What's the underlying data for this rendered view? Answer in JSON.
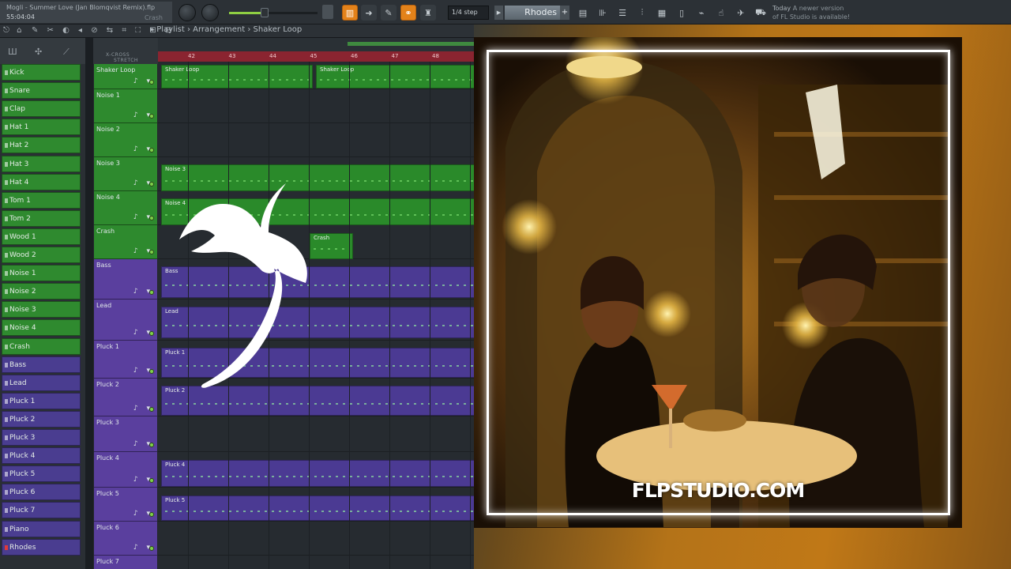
{
  "project": {
    "title": "Mogli - Summer Love (Jan Blomqvist Remix).flp",
    "time": "55:04:04",
    "hint_label": "Crash"
  },
  "toolbar": {
    "snap_value": "1/4 step",
    "pattern_name": "Rhodes",
    "pattern_add": "+",
    "news_date": "Today",
    "news_text_1": "A newer version",
    "news_text_2": "of FL Studio is available!",
    "master_volume_percent": 40,
    "accent_color": "#e3821a"
  },
  "breadcrumb": {
    "root": "Playlist",
    "sep1": "›",
    "section": "Arrangement",
    "sep2": "›",
    "item": "Shaker Loop"
  },
  "rack_header_icons": [
    "piano-icon",
    "step-icon",
    "graph-icon"
  ],
  "channels": [
    {
      "label": "Kick",
      "color": "g"
    },
    {
      "label": "Snare",
      "color": "g"
    },
    {
      "label": "Clap",
      "color": "g"
    },
    {
      "label": "Hat 1",
      "color": "g"
    },
    {
      "label": "Hat 2",
      "color": "g"
    },
    {
      "label": "Hat 3",
      "color": "g"
    },
    {
      "label": "Hat 4",
      "color": "g"
    },
    {
      "label": "Tom 1",
      "color": "g"
    },
    {
      "label": "Tom 2",
      "color": "g"
    },
    {
      "label": "Wood 1",
      "color": "g"
    },
    {
      "label": "Wood 2",
      "color": "g"
    },
    {
      "label": "Noise 1",
      "color": "g"
    },
    {
      "label": "Noise 2",
      "color": "g"
    },
    {
      "label": "Noise 3",
      "color": "g"
    },
    {
      "label": "Noise 4",
      "color": "g"
    },
    {
      "label": "Crash",
      "color": "g"
    },
    {
      "label": "Bass",
      "color": "p"
    },
    {
      "label": "Lead",
      "color": "p"
    },
    {
      "label": "Pluck 1",
      "color": "p"
    },
    {
      "label": "Pluck 2",
      "color": "p"
    },
    {
      "label": "Pluck 3",
      "color": "p"
    },
    {
      "label": "Pluck 4",
      "color": "p"
    },
    {
      "label": "Pluck 5",
      "color": "p"
    },
    {
      "label": "Pluck 6",
      "color": "p"
    },
    {
      "label": "Pluck 7",
      "color": "p"
    },
    {
      "label": "Piano",
      "color": "p"
    },
    {
      "label": "Rhodes",
      "color": "r"
    }
  ],
  "tracks_header": {
    "crossfade": "X-CROSS",
    "stretch": "STRETCH"
  },
  "tracks": [
    {
      "label": "Shaker Loop",
      "color": "g"
    },
    {
      "label": "Noise 1",
      "color": "g"
    },
    {
      "label": "Noise 2",
      "color": "g"
    },
    {
      "label": "Noise 3",
      "color": "g"
    },
    {
      "label": "Noise 4",
      "color": "g"
    },
    {
      "label": "Crash",
      "color": "g"
    },
    {
      "label": "Bass",
      "color": "p"
    },
    {
      "label": "Lead",
      "color": "p"
    },
    {
      "label": "Pluck 1",
      "color": "p"
    },
    {
      "label": "Pluck 2",
      "color": "p"
    },
    {
      "label": "Pluck 3",
      "color": "p"
    },
    {
      "label": "Pluck 4",
      "color": "p"
    },
    {
      "label": "Pluck 5",
      "color": "p"
    },
    {
      "label": "Pluck 6",
      "color": "p"
    },
    {
      "label": "Pluck 7",
      "color": "p"
    }
  ],
  "ruler_bars": [
    "42",
    "43",
    "44",
    "45",
    "46",
    "47",
    "48"
  ],
  "clips": [
    {
      "label": "Shaker Loop",
      "color": "g"
    },
    {
      "label": "Shaker Loop",
      "color": "g"
    },
    {
      "label": "Noise 3",
      "color": "g"
    },
    {
      "label": "Noise 4",
      "color": "g"
    },
    {
      "label": "Crash",
      "color": "g"
    },
    {
      "label": "Bass",
      "color": "p"
    },
    {
      "label": "Lead",
      "color": "p"
    },
    {
      "label": "Pluck 1",
      "color": "p"
    },
    {
      "label": "Pluck 2",
      "color": "p"
    },
    {
      "label": "Pluck 4",
      "color": "p"
    },
    {
      "label": "Pluck 5",
      "color": "p"
    }
  ],
  "watermark": "FLPSTUDIO.COM"
}
